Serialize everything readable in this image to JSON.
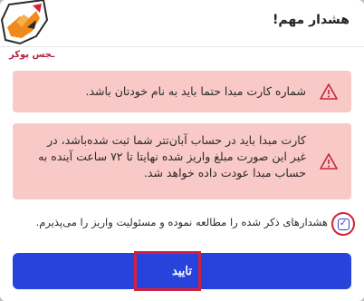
{
  "dialog": {
    "title": "هشدار مهم!",
    "logo_text": "ـجس پوکر",
    "alerts": [
      {
        "icon": "warning-icon",
        "text": "شماره کارت مبدا حتما باید به نام خودتان باشد."
      },
      {
        "icon": "warning-icon",
        "text": "کارت مبدا باید در حساب آبان‌تتر شما ثبت شده‌باشد، در غیر این صورت مبلغ واریز شده نهایتا تا ۷۲ ساعت آینده به حساب مبدا عودت داده خواهد شد."
      }
    ],
    "agreement_text": "هشدارهای ذکر شده را مطالعه نموده و مسئولیت واریز را می‌پذیرم.",
    "agreement_checked": true,
    "confirm_label": "تایید"
  },
  "colors": {
    "alert_bg": "#f8c9c6",
    "alert_icon": "#c0283a",
    "primary": "#2843dc",
    "highlight": "#d4213a"
  }
}
